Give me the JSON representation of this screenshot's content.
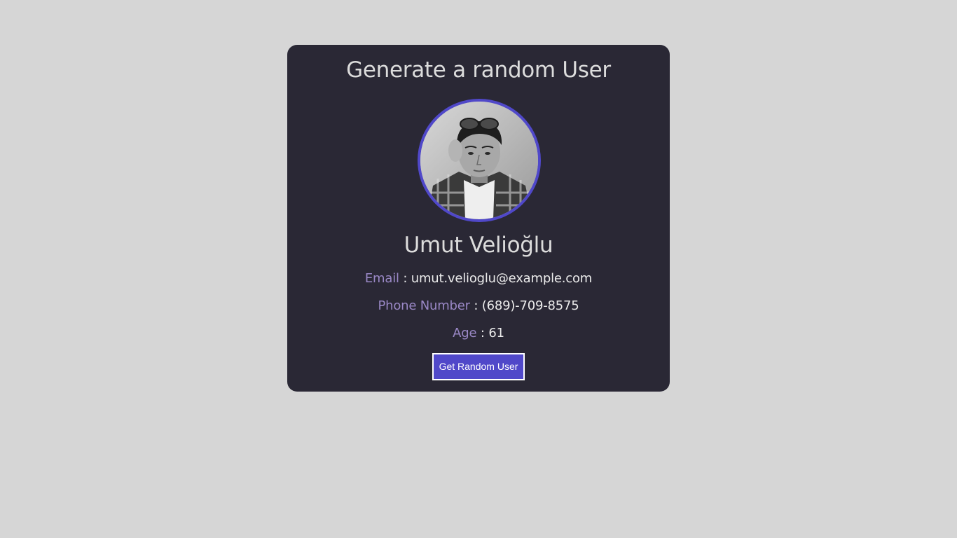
{
  "title": "Generate a random User",
  "user": {
    "name": "Umut Velioğlu",
    "email_label": "Email",
    "email": "umut.velioglu@example.com",
    "phone_label": "Phone Number",
    "phone": "(689)-709-8575",
    "age_label": "Age",
    "age": "61"
  },
  "separator": ":",
  "button_label": "Get Random User",
  "colors": {
    "background": "#d6d6d6",
    "card": "#2a2835",
    "accent": "#5048c9",
    "label": "#9a88c6",
    "text": "#dcdcdc"
  }
}
